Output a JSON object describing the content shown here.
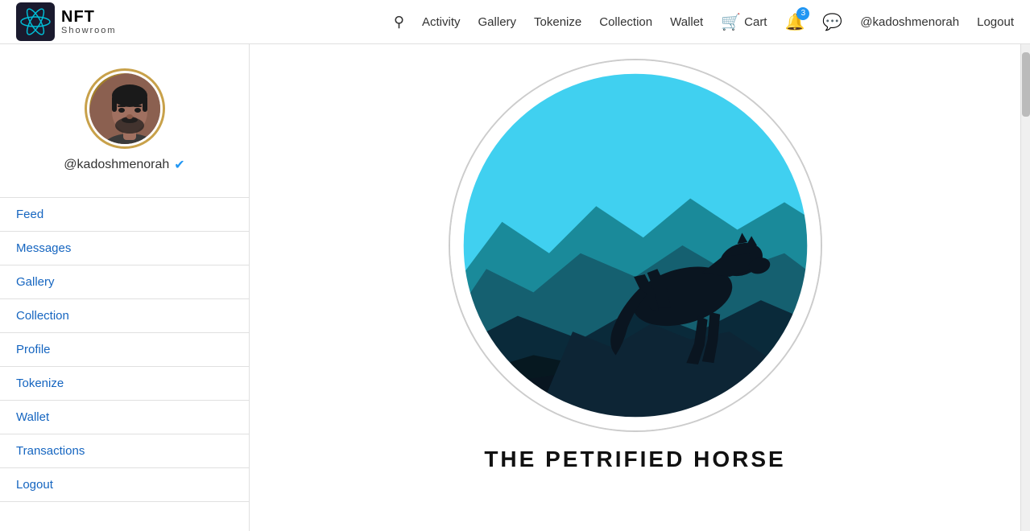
{
  "header": {
    "logo_nft": "NFT",
    "logo_showroom": "Showroom",
    "nav": {
      "search_label": "Search",
      "activity": "Activity",
      "gallery": "Gallery",
      "tokenize": "Tokenize",
      "collection": "Collection",
      "wallet": "Wallet",
      "cart": "Cart",
      "cart_count": "3",
      "username": "@kadoshmenorah",
      "logout": "Logout"
    }
  },
  "sidebar": {
    "username": "@kadoshmenorah",
    "items": [
      {
        "id": "feed",
        "label": "Feed"
      },
      {
        "id": "messages",
        "label": "Messages"
      },
      {
        "id": "gallery",
        "label": "Gallery"
      },
      {
        "id": "collection",
        "label": "Collection"
      },
      {
        "id": "profile",
        "label": "Profile"
      },
      {
        "id": "tokenize",
        "label": "Tokenize"
      },
      {
        "id": "wallet",
        "label": "Wallet"
      },
      {
        "id": "transactions",
        "label": "Transactions"
      },
      {
        "id": "logout",
        "label": "Logout"
      }
    ]
  },
  "content": {
    "nft_title": "THE PETRIFIED HORSE"
  }
}
